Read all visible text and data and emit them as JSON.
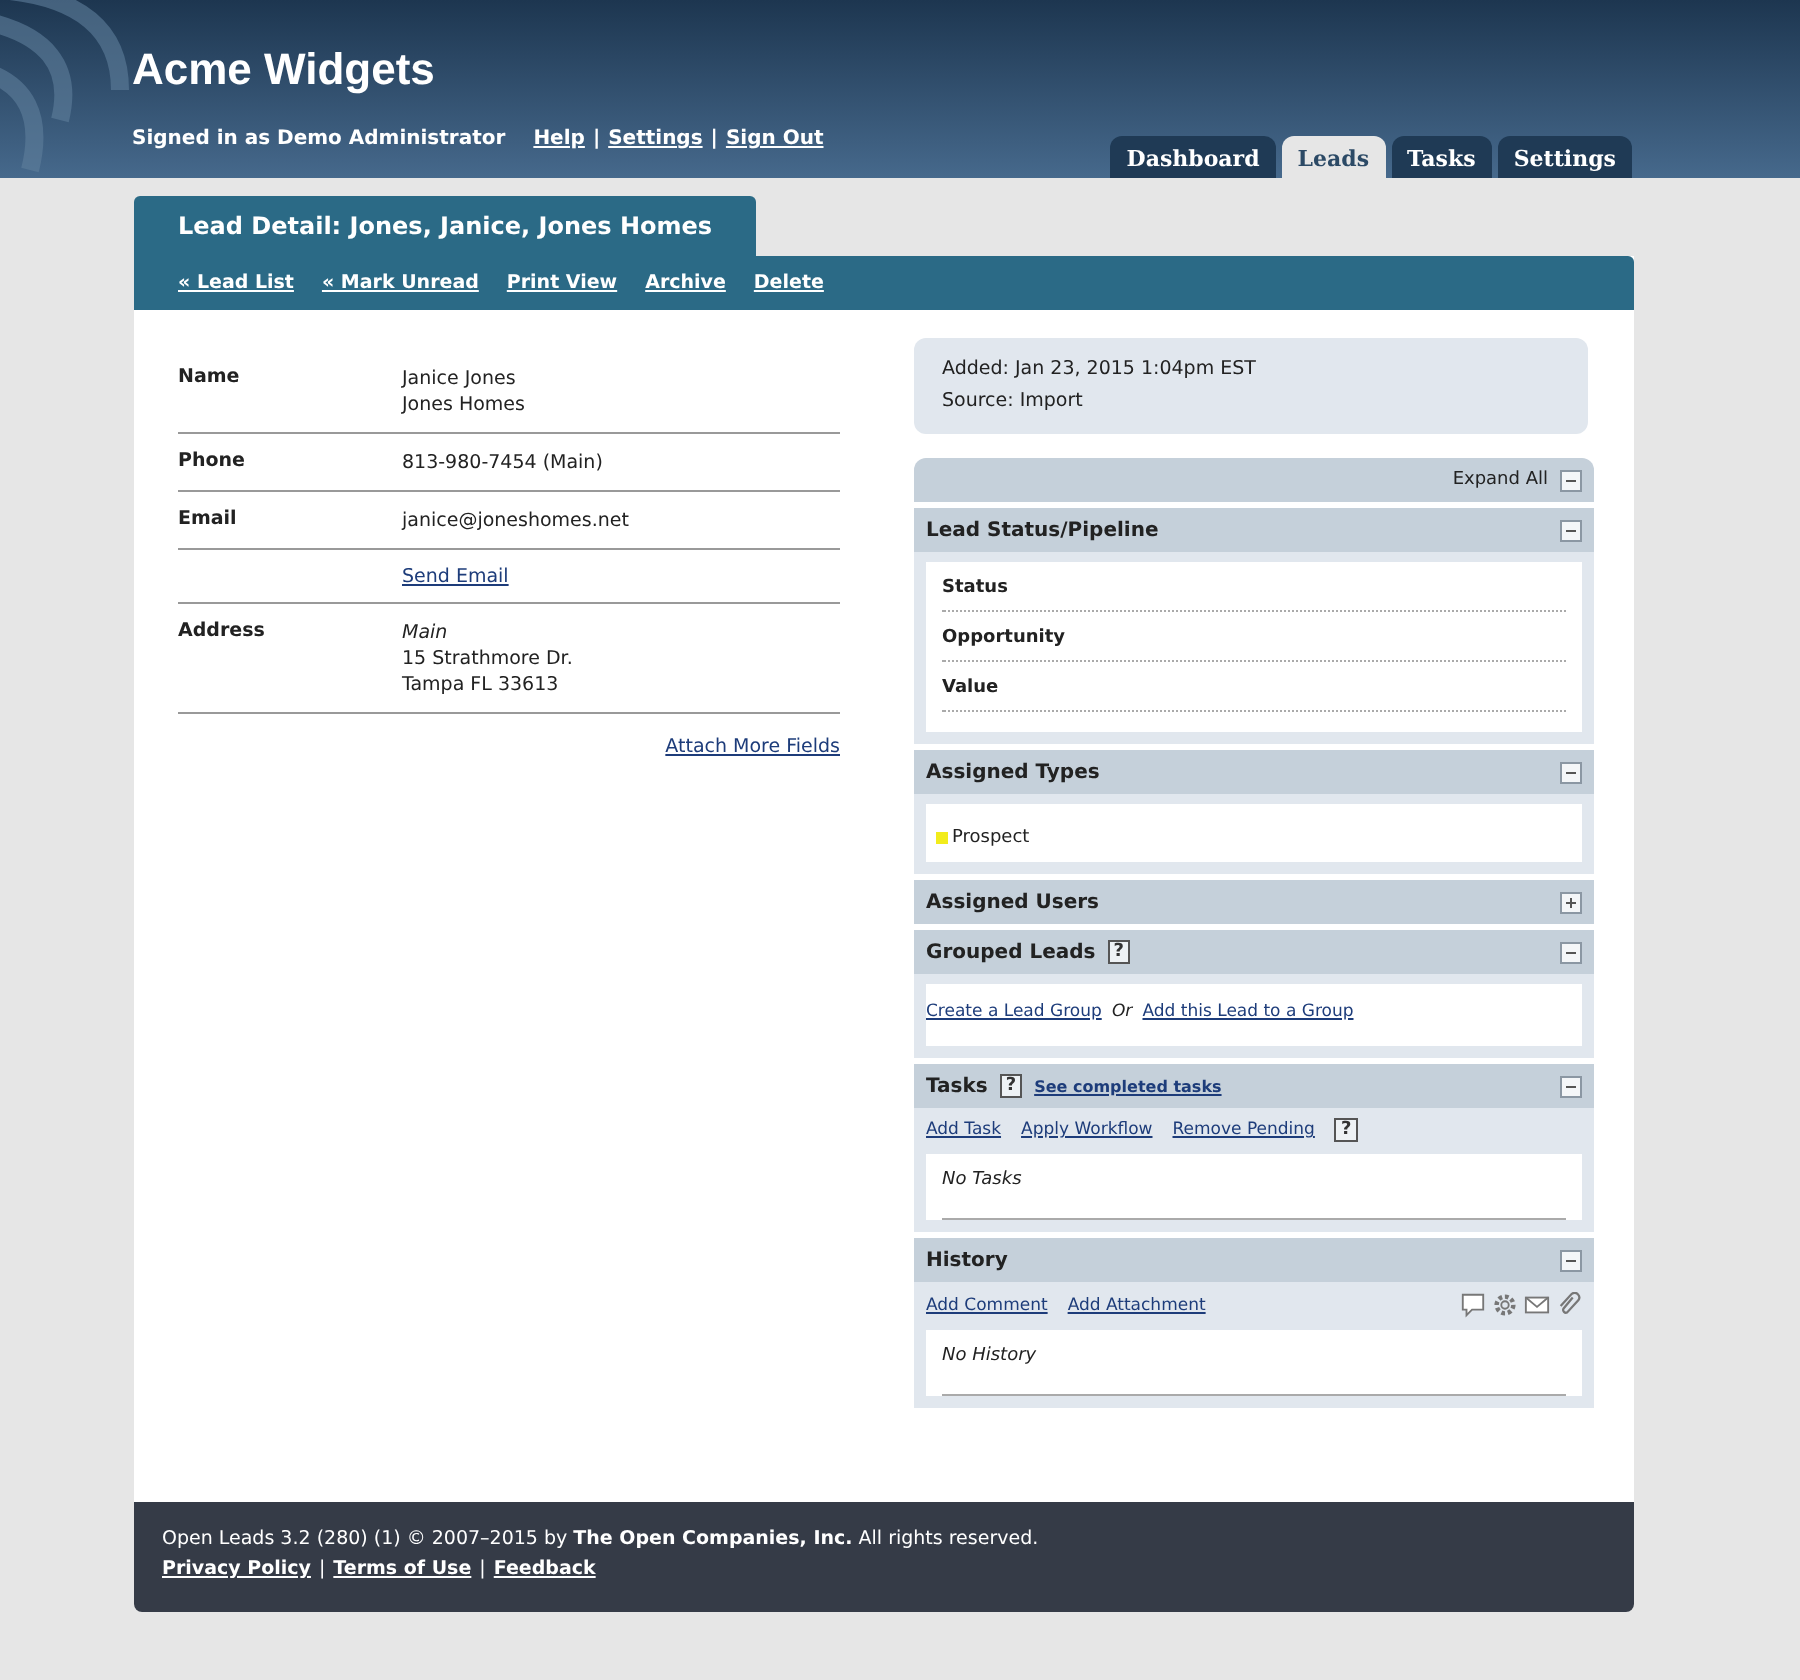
{
  "header": {
    "app_title": "Acme Widgets",
    "signed_in": "Signed in as Demo Administrator",
    "links": [
      "Help",
      "Settings",
      "Sign Out"
    ],
    "separator": "|"
  },
  "tabs": [
    {
      "label": "Dashboard",
      "selected": false
    },
    {
      "label": "Leads",
      "selected": true
    },
    {
      "label": "Tasks",
      "selected": false
    },
    {
      "label": "Settings",
      "selected": false
    }
  ],
  "page_title": "Lead Detail: Jones, Janice, Jones Homes",
  "actions": [
    "« Lead List",
    "« Mark Unread",
    "Print View",
    "Archive",
    "Delete"
  ],
  "fields": [
    {
      "kind": "text",
      "label": "Name",
      "lines": [
        {
          "text": "Janice Jones",
          "italic": false
        },
        {
          "text": "Jones Homes",
          "italic": false
        }
      ]
    },
    {
      "kind": "text",
      "label": "Phone",
      "lines": [
        {
          "text": "813-980-7454 (Main)",
          "italic": false
        }
      ]
    },
    {
      "kind": "text",
      "label": "Email",
      "lines": [
        {
          "text": "janice@joneshomes.net",
          "italic": false
        }
      ]
    },
    {
      "kind": "link",
      "link": "Send Email"
    },
    {
      "kind": "text",
      "label": "Address",
      "lines": [
        {
          "text": "Main",
          "italic": true
        },
        {
          "text": "15 Strathmore Dr.",
          "italic": false
        },
        {
          "text": "Tampa FL 33613",
          "italic": false
        }
      ]
    }
  ],
  "attach_link": "Attach More Fields",
  "info": [
    "Added: Jan 23, 2015 1:04pm EST",
    "Source: Import"
  ],
  "expand_all": "Expand All",
  "sections": [
    {
      "kind": "fields",
      "title": "Lead Status/Pipeline",
      "expanded": true,
      "items": [
        "Status",
        "Opportunity",
        "Value"
      ]
    },
    {
      "kind": "types",
      "title": "Assigned Types",
      "expanded": true,
      "items": [
        {
          "label": "Prospect",
          "color": "#f2ec1c"
        }
      ]
    },
    {
      "title": "Assigned Users",
      "expanded": false
    },
    {
      "kind": "groups",
      "title": "Grouped Leads",
      "expanded": true,
      "help": "?",
      "links": [
        "Create a Lead Group",
        "Add this Lead to a Group"
      ],
      "joiner": "Or"
    },
    {
      "kind": "tasks",
      "title": "Tasks",
      "expanded": true,
      "help": "?",
      "header_link": "See completed tasks",
      "links": [
        "Add Task",
        "Apply Workflow",
        "Remove Pending"
      ],
      "links_help": "?",
      "empty": "No Tasks"
    },
    {
      "kind": "history",
      "title": "History",
      "expanded": true,
      "links": [
        "Add Comment",
        "Add Attachment"
      ],
      "empty": "No History"
    }
  ],
  "footer": {
    "copyright": "Open Leads 3.2 (280) (1) © 2007–2015 by **The Open Companies, Inc.** All rights reserved.",
    "links": [
      "Privacy Policy",
      "Terms of Use",
      "Feedback"
    ],
    "separator": "|"
  }
}
